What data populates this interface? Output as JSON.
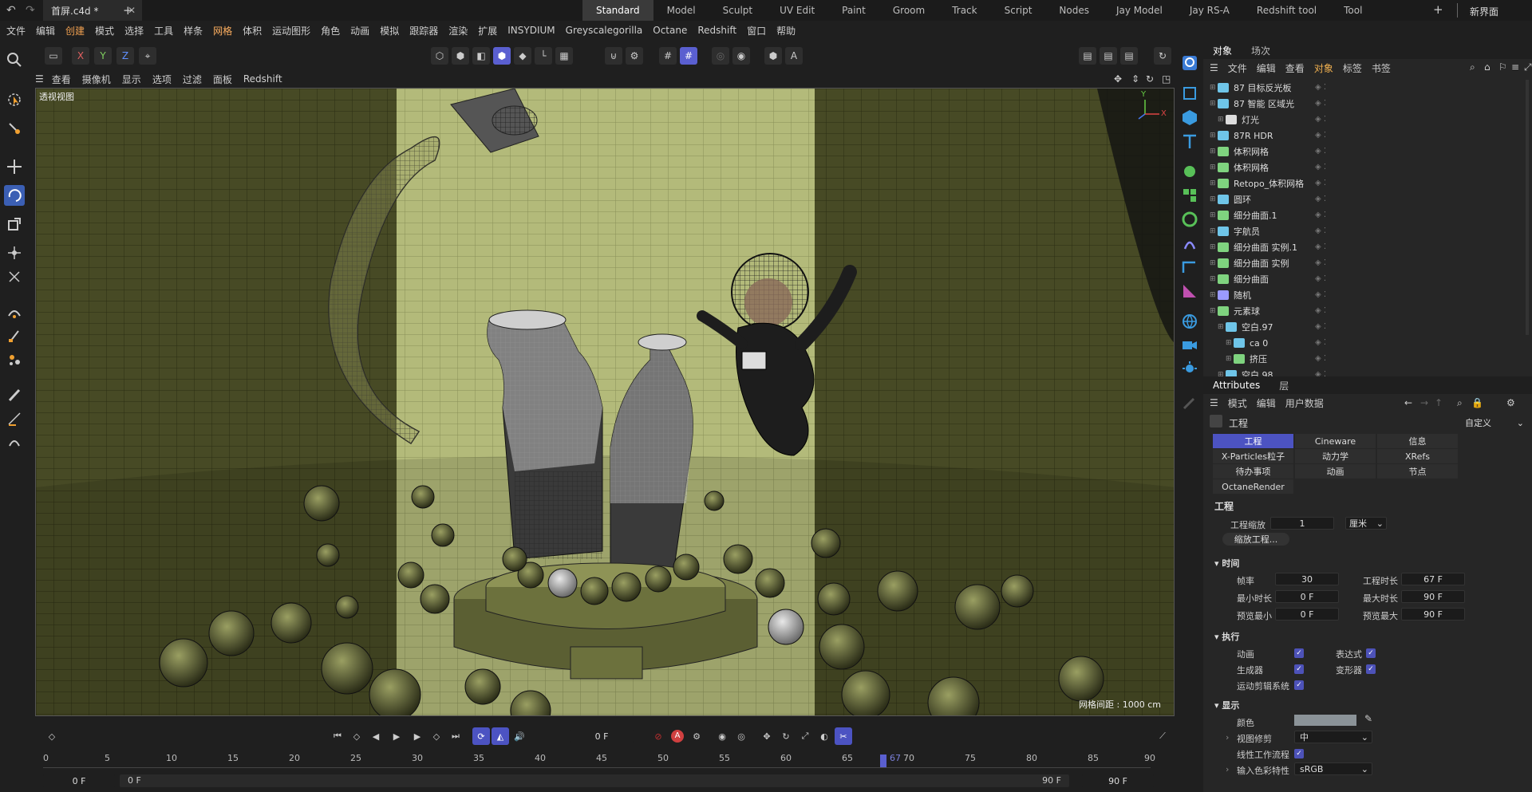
{
  "titlebar": {
    "file_tab": "首屏.c4d *",
    "plus": "+",
    "new_interface": "新界面"
  },
  "layouts": [
    "Standard",
    "Model",
    "Sculpt",
    "UV Edit",
    "Paint",
    "Groom",
    "Track",
    "Script",
    "Nodes",
    "Jay Model",
    "Jay RS-A",
    "Redshift tool",
    "Tool"
  ],
  "menu": [
    "文件",
    "编辑",
    "创建",
    "模式",
    "选择",
    "工具",
    "样条",
    "网格",
    "体积",
    "运动图形",
    "角色",
    "动画",
    "模拟",
    "跟踪器",
    "渲染",
    "扩展",
    "INSYDIUM",
    "Greyscalegorilla",
    "Octane",
    "Redshift",
    "窗口",
    "帮助"
  ],
  "viewport_menu": [
    "查看",
    "摄像机",
    "显示",
    "选项",
    "过滤",
    "面板",
    "Redshift"
  ],
  "viewport": {
    "title": "透视视图",
    "grid_label": "网格间距 : 1000 cm",
    "axis_x": "X",
    "axis_y": "Y"
  },
  "axis_buttons": [
    "X",
    "Y",
    "Z"
  ],
  "object_panel": {
    "tabs": [
      "对象",
      "场次"
    ],
    "menu": [
      "文件",
      "编辑",
      "查看",
      "对象",
      "标签",
      "书签"
    ],
    "items": [
      {
        "name": "87 目标反光板",
        "color": "#6fc5e8"
      },
      {
        "name": "87 智能 区域光",
        "color": "#6fc5e8"
      },
      {
        "name": "灯光",
        "color": "#dddddd"
      },
      {
        "name": "87R HDR",
        "color": "#6fc5e8"
      },
      {
        "name": "体积网格",
        "color": "#7fd37f"
      },
      {
        "name": "体积网格",
        "color": "#7fd37f"
      },
      {
        "name": "Retopo_体积网格",
        "color": "#7fd37f"
      },
      {
        "name": "圆环",
        "color": "#6fc5e8"
      },
      {
        "name": "细分曲面.1",
        "color": "#7fd37f"
      },
      {
        "name": "字航员",
        "color": "#6fc5e8"
      },
      {
        "name": "细分曲面 实例.1",
        "color": "#7fd37f"
      },
      {
        "name": "细分曲面 实例",
        "color": "#7fd37f"
      },
      {
        "name": "细分曲面",
        "color": "#7fd37f"
      },
      {
        "name": "随机",
        "color": "#9a9aff"
      },
      {
        "name": "元素球",
        "color": "#7fd37f"
      },
      {
        "name": "空白.97",
        "color": "#6fc5e8"
      },
      {
        "name": "ca 0",
        "color": "#6fc5e8"
      },
      {
        "name": "挤压",
        "color": "#7fd37f"
      },
      {
        "name": "空白.98",
        "color": "#6fc5e8"
      }
    ]
  },
  "attributes": {
    "tabs": [
      "Attributes",
      "层"
    ],
    "menu": [
      "模式",
      "编辑",
      "用户数据"
    ],
    "header": "工程",
    "preset": "自定义",
    "subtabs_row1": [
      "工程",
      "Cineware",
      "信息"
    ],
    "subtabs_row2": [
      "X-Particles粒子",
      "动力学",
      "XRefs"
    ],
    "subtabs_row3": [
      "待办事项",
      "动画",
      "节点"
    ],
    "subtabs_row4": [
      "OctaneRender"
    ],
    "section_project": "工程",
    "project_scale_label": "工程缩放",
    "project_scale_value": "1",
    "project_scale_unit": "厘米",
    "scale_button": "缩放工程...",
    "section_time": "时间",
    "fps_label": "帧率",
    "fps_value": "30",
    "proj_len_label": "工程时长",
    "proj_len_value": "67 F",
    "min_len_label": "最小时长",
    "min_len_value": "0 F",
    "max_len_label": "最大时长",
    "max_len_value": "90 F",
    "prev_min_label": "预览最小",
    "prev_min_value": "0 F",
    "prev_max_label": "预览最大",
    "prev_max_value": "90 F",
    "section_exec": "执行",
    "exec_anim": "动画",
    "exec_expr": "表达式",
    "exec_gen": "生成器",
    "exec_deform": "变形器",
    "exec_motion": "运动剪辑系统",
    "section_display": "显示",
    "color_label": "颜色",
    "lod_label": "视图修剪",
    "lod_value": "中",
    "linear_label": "线性工作流程",
    "input_label": "输入色彩特性",
    "input_value": "sRGB"
  },
  "timeline": {
    "current_frame": "0 F",
    "ticks": [
      "0",
      "5",
      "10",
      "15",
      "20",
      "25",
      "30",
      "35",
      "40",
      "45",
      "50",
      "55",
      "60",
      "65",
      "70",
      "75",
      "80",
      "85",
      "90"
    ],
    "playhead_label": "67",
    "start_field": "0 F",
    "range_start": "0 F",
    "range_end": "90 F",
    "end_field": "90 F"
  }
}
